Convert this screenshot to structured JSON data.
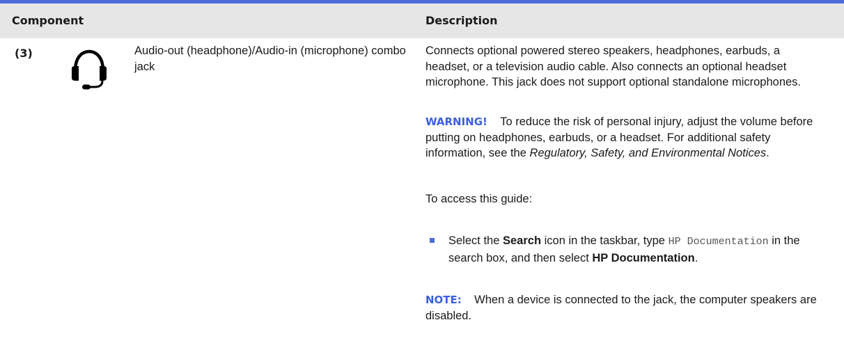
{
  "table": {
    "header": {
      "component": "Component",
      "description": "Description"
    },
    "row": {
      "callout": "(3)",
      "icon": "headset-icon",
      "component_name": "Audio-out (headphone)/Audio-in (microphone) combo jack",
      "description": {
        "paragraph1": "Connects optional powered stereo speakers, headphones, earbuds, a headset, or a television audio cable. Also connects an optional headset microphone. This jack does not support optional standalone microphones.",
        "warning": {
          "label": "WARNING!",
          "text": "To reduce the risk of personal injury, adjust the volume before putting on headphones, earbuds, or a headset. For additional safety information, see the",
          "doc_title": "Regulatory, Safety, and Environmental Notices",
          "end": "."
        },
        "access_intro": "To access this guide:",
        "bullet": {
          "t1": "Select the",
          "b1": "Search",
          "t2": "icon in the taskbar, type",
          "mono": "HP Documentation",
          "t3": "in the search box, and then select",
          "b2": "HP Documentation",
          "t4": "."
        },
        "note": {
          "label": "NOTE:",
          "text": "When a device is connected to the jack, the computer speakers are disabled."
        }
      }
    }
  },
  "colors": {
    "accent": "#4f6bd8",
    "header_bg": "#e6e6e6",
    "label_blue": "#3a5fe0"
  }
}
